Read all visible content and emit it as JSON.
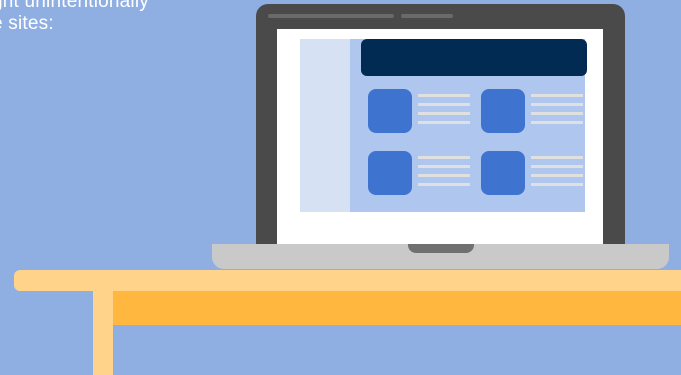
{
  "caption": {
    "line1": "ght unintentionally",
    "line2": "e sites:"
  },
  "colors": {
    "background": "#8FAFE3",
    "laptop_frame": "#4a4a4a",
    "header_bar": "#012B52",
    "tile": "#3E74CF",
    "desk_top": "#FFD38A",
    "desk_front": "#FFB73F"
  },
  "illustration": {
    "subject": "laptop-on-desk",
    "screen_tiles": 4
  }
}
